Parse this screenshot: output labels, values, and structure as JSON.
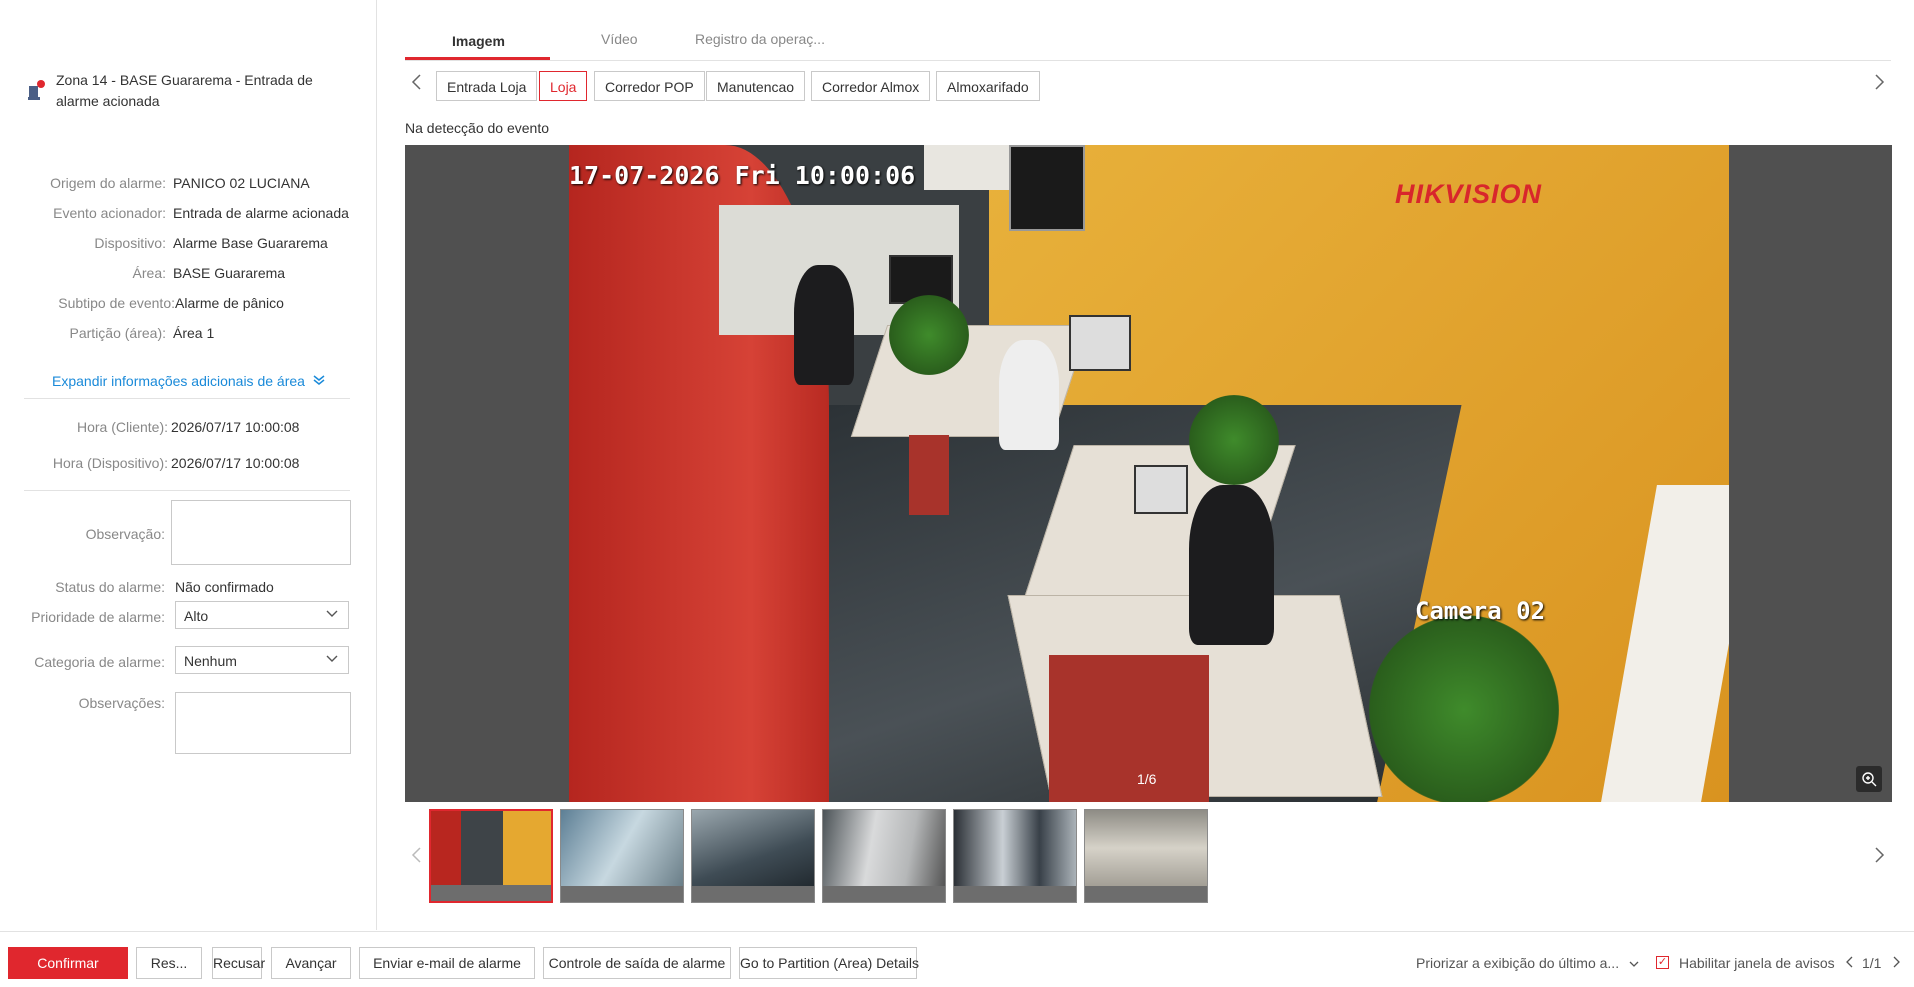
{
  "alarm": {
    "title": "Zona 14 - BASE Guararema - Entrada de alarme acionada"
  },
  "details": [
    {
      "label": "Origem do alarme:",
      "value": "PANICO 02 LUCIANA"
    },
    {
      "label": "Evento acionador:",
      "value": "Entrada de alarme acionada"
    },
    {
      "label": "Dispositivo:",
      "value": "Alarme Base Guararema"
    },
    {
      "label": "Área:",
      "value": "BASE Guararema"
    },
    {
      "label": "Subtipo de evento:",
      "value": "Alarme de pânico"
    },
    {
      "label": "Partição (área):",
      "value": "Área 1"
    }
  ],
  "expand_label": "Expandir informações adicionais de área",
  "times": [
    {
      "label": "Hora (Cliente):",
      "value": "2026/07/17 10:00:08"
    },
    {
      "label": "Hora (Dispositivo):",
      "value": "2026/07/17 10:00:08"
    }
  ],
  "form": {
    "observation_label": "Observação:",
    "status_label": "Status do alarme:",
    "status_value": "Não confirmado",
    "priority_label": "Prioridade de alarme:",
    "priority_value": "Alto",
    "category_label": "Categoria de alarme:",
    "category_value": "Nenhum",
    "notes_label": "Observações:"
  },
  "tabs": [
    "Imagem",
    "Vídeo",
    "Registro da operaç..."
  ],
  "cameras": [
    "Entrada Loja",
    "Loja",
    "Corredor POP",
    "Manutencao",
    "Corredor Almox",
    "Almoxarifado"
  ],
  "active_camera": "Loja",
  "caption": "Na detecção do evento",
  "viewer": {
    "timestamp": "17-07-2026 Fri 10:00:06",
    "brand": "HIKVISION",
    "camera_label": "Camera 02",
    "counter": "1/6"
  },
  "thumb_count": 6,
  "footer": {
    "confirm": "Confirmar",
    "res": "Res...",
    "refuse": "Recusar",
    "advance": "Avançar",
    "email": "Enviar e-mail de alarme",
    "output": "Controle de saída de alarme",
    "partition": "Go to Partition (Area) Details",
    "prioritize": "Priorizar a exibição do último a...",
    "enable_popup": "Habilitar janela de avisos",
    "pager": "1/1"
  },
  "colors": {
    "accent": "#e0272e",
    "link": "#1a8ad9"
  }
}
